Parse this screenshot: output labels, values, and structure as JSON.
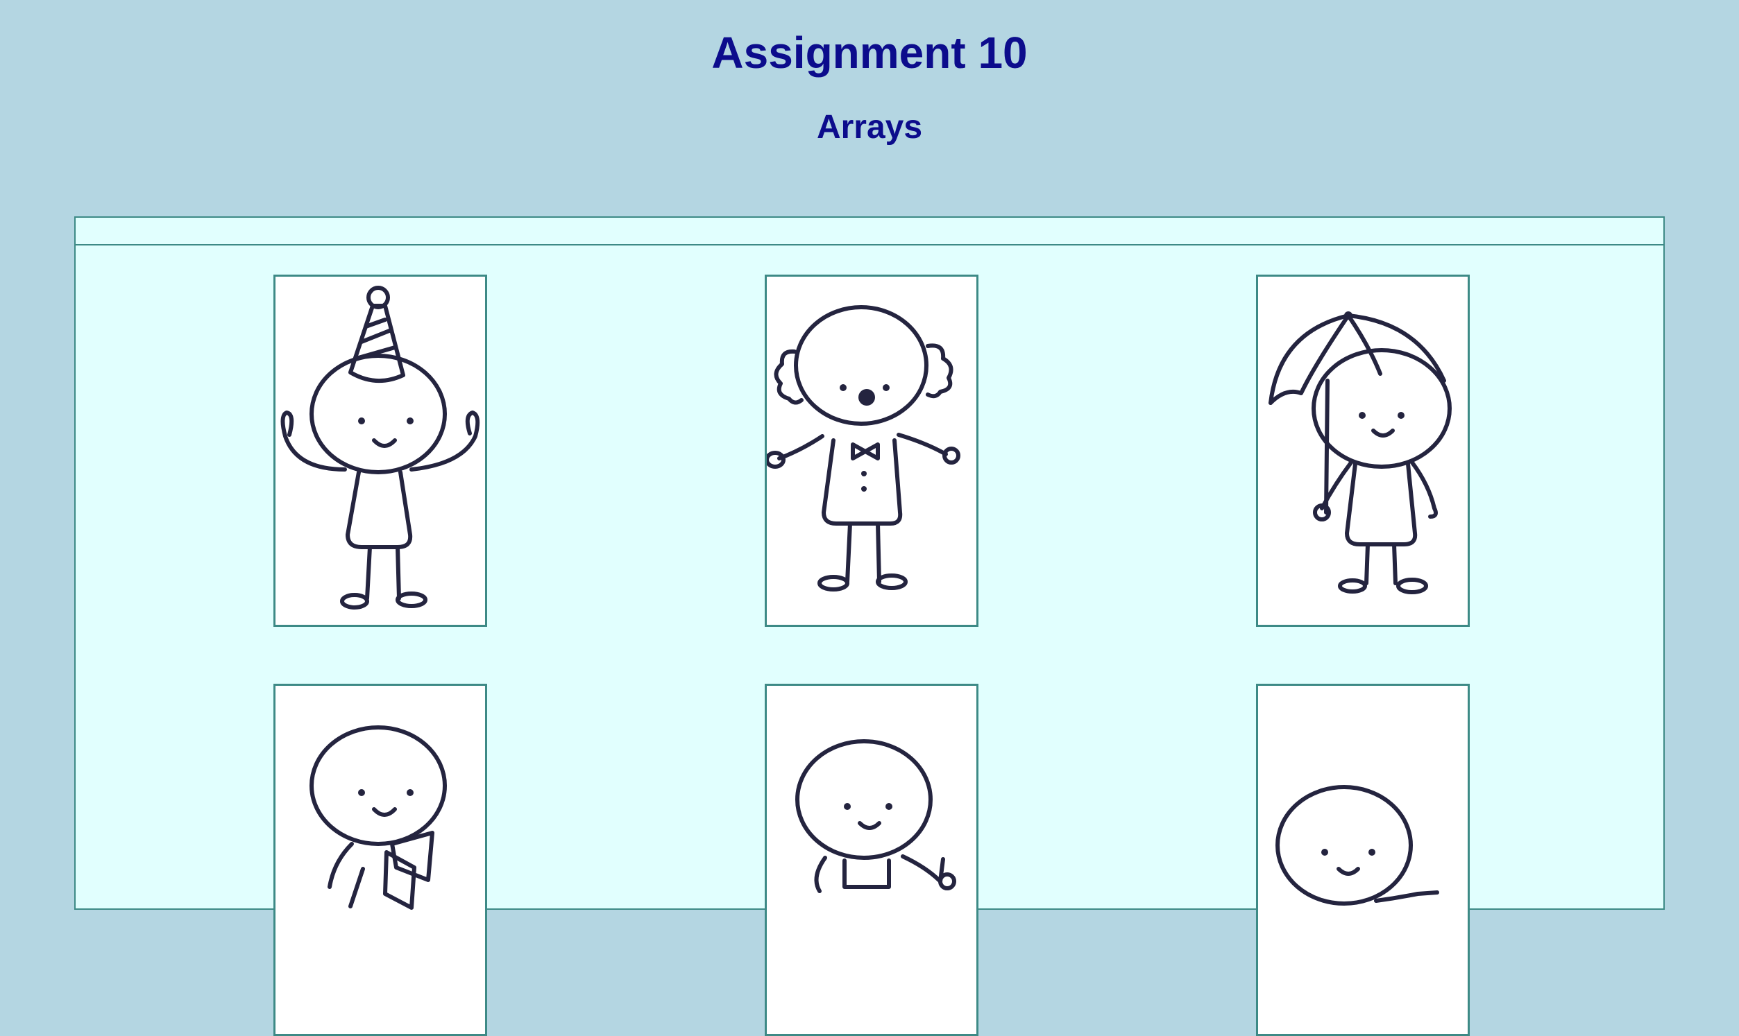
{
  "header": {
    "title": "Assignment 10",
    "subtitle": "Arrays"
  },
  "gallery": {
    "items": [
      {
        "figure": "party-hat-stickman"
      },
      {
        "figure": "clown-stickman"
      },
      {
        "figure": "umbrella-stickman"
      },
      {
        "figure": "book-stickman"
      },
      {
        "figure": "overalls-stickman"
      },
      {
        "figure": "waving-stickman"
      }
    ]
  },
  "colors": {
    "background": "#b4d6e2",
    "panel": "#e1fffe",
    "border": "#3d8a86",
    "title": "#0c0c8c",
    "ink": "#24243f"
  }
}
